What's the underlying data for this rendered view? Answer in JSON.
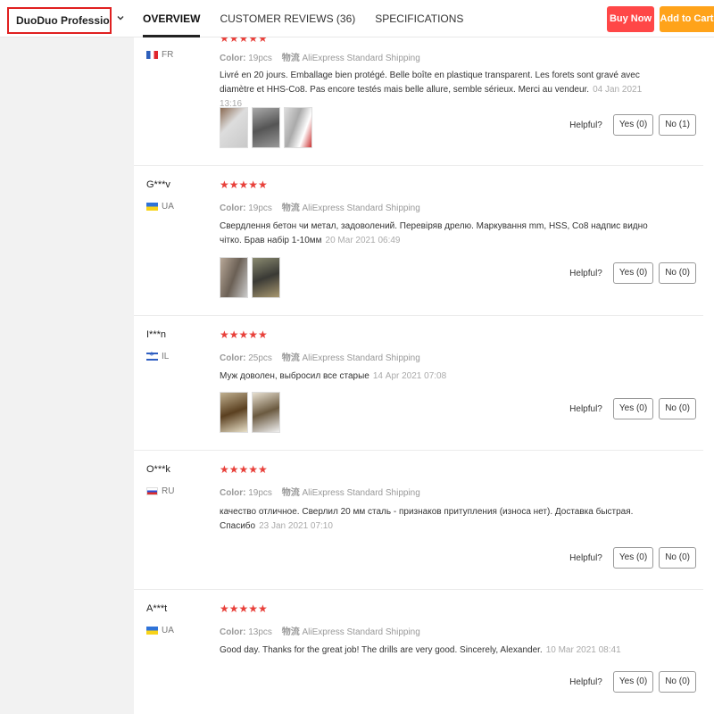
{
  "header": {
    "product_name": "DuoDuo Profession...",
    "tabs": [
      {
        "label": "OVERVIEW"
      },
      {
        "label": "CUSTOMER REVIEWS (36)"
      },
      {
        "label": "SPECIFICATIONS"
      }
    ],
    "buy_now": "Buy Now",
    "add_to_cart": "Add to Cart"
  },
  "reviews": [
    {
      "name": "",
      "country": "FR",
      "color_label": "Color:",
      "color": "19pcs",
      "ship_icon": "物流",
      "shipping": "AliExpress Standard Shipping",
      "text": "Livré en 20 jours. Emballage bien protégé. Belle boîte en plastique transparent. Les forets sont gravé avec diamètre et HHS-Co8. Pas encore testés mais belle allure, semble sérieux. Merci au vendeur.",
      "date": "04 Jan 2021 13:16",
      "helpful": "Helpful?",
      "yes": "Yes (0)",
      "no": "No (1)"
    },
    {
      "name": "G***v",
      "country": "UA",
      "color_label": "Color:",
      "color": "19pcs",
      "ship_icon": "物流",
      "shipping": "AliExpress Standard Shipping",
      "text": "Свердлення бетон чи метал, задоволений. Перевіряв дрелю. Маркування mm, HSS, Co8 надпис видно чітко. Брав набір 1-10мм",
      "date": "20 Mar 2021 06:49",
      "helpful": "Helpful?",
      "yes": "Yes (0)",
      "no": "No (0)"
    },
    {
      "name": "I***n",
      "country": "IL",
      "color_label": "Color:",
      "color": "25pcs",
      "ship_icon": "物流",
      "shipping": "AliExpress Standard Shipping",
      "text": "Муж доволен, выбросил все старые",
      "date": "14 Apr 2021 07:08",
      "helpful": "Helpful?",
      "yes": "Yes (0)",
      "no": "No (0)"
    },
    {
      "name": "O***k",
      "country": "RU",
      "color_label": "Color:",
      "color": "19pcs",
      "ship_icon": "物流",
      "shipping": "AliExpress Standard Shipping",
      "text": "качество отличное. Сверлил 20 мм сталь - признаков притупления (износа нет). Доставка быстрая. Спасибо",
      "date": "23 Jan 2021 07:10",
      "helpful": "Helpful?",
      "yes": "Yes (0)",
      "no": "No (0)"
    },
    {
      "name": "A***t",
      "country": "UA",
      "color_label": "Color:",
      "color": "13pcs",
      "ship_icon": "物流",
      "shipping": "AliExpress Standard Shipping",
      "text": "Good day. Thanks for the great job! The drills are very good. Sincerely, Alexander.",
      "date": "10 Mar 2021 08:41",
      "helpful": "Helpful?",
      "yes": "Yes (0)",
      "no": "No (0)"
    }
  ],
  "rating_stars": "★★★★★",
  "colors": {
    "accent": "#ff4747",
    "cart": "#ffa31a",
    "star": "#e8403a",
    "highlight_border": "#e02020"
  }
}
